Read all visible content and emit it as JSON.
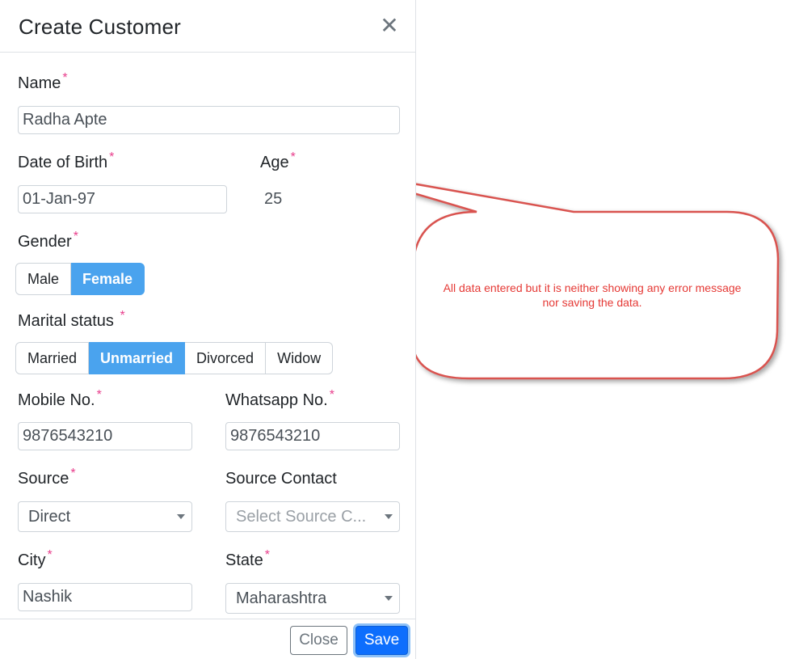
{
  "modal": {
    "title": "Create Customer",
    "close_glyph": "✕"
  },
  "fields": {
    "name": {
      "label": "Name",
      "value": "Radha Apte"
    },
    "dob": {
      "label": "Date of Birth",
      "value": "01-Jan-97"
    },
    "age": {
      "label": "Age",
      "value": "25"
    },
    "gender": {
      "label": "Gender",
      "options": [
        "Male",
        "Female"
      ],
      "selected": "Female"
    },
    "marital": {
      "label": "Marital status",
      "options": [
        "Married",
        "Unmarried",
        "Divorced",
        "Widow"
      ],
      "selected": "Unmarried"
    },
    "mobile": {
      "label": "Mobile No.",
      "value": "9876543210"
    },
    "whatsapp": {
      "label": "Whatsapp No.",
      "value": "9876543210"
    },
    "source": {
      "label": "Source",
      "value": "Direct"
    },
    "source_contact": {
      "label": "Source Contact",
      "placeholder": "Select Source C..."
    },
    "city": {
      "label": "City",
      "value": "Nashik"
    },
    "state": {
      "label": "State",
      "value": "Maharashtra"
    }
  },
  "required_mark": "*",
  "footer": {
    "close_label": "Close",
    "save_label": "Save"
  },
  "annotation": {
    "text": "All data entered but it is neither showing any error message nor saving the data.",
    "color": "#e53935"
  },
  "colors": {
    "active_segment": "#4aa3ee",
    "primary": "#0d6efd",
    "required": "#e83e8c"
  }
}
